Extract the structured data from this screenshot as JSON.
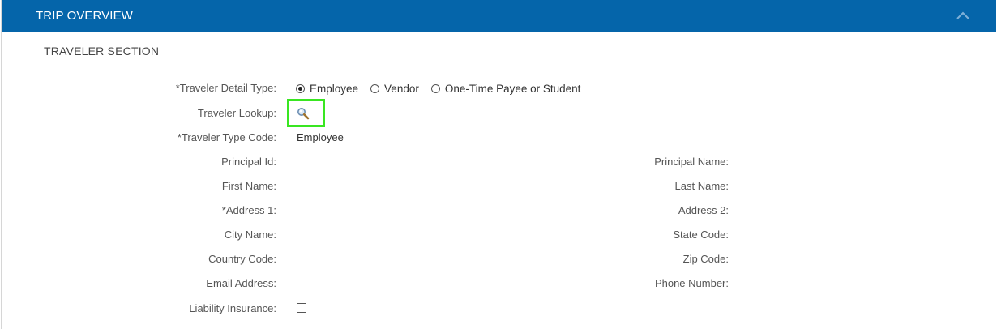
{
  "header": {
    "title": "TRIP OVERVIEW",
    "collapse_icon": "chevron-up-icon",
    "background": "#0565aa"
  },
  "section": {
    "title": "TRAVELER SECTION"
  },
  "traveler_detail_type": {
    "label": "*Traveler Detail Type:",
    "options": [
      {
        "label": "Employee",
        "checked": true
      },
      {
        "label": "Vendor",
        "checked": false
      },
      {
        "label": "One-Time Payee or Student",
        "checked": false
      }
    ]
  },
  "traveler_lookup": {
    "label": "Traveler Lookup:",
    "icon": "magnifier-icon",
    "highlight": "#39e621"
  },
  "traveler_type_code": {
    "label": "*Traveler Type Code:",
    "value": "Employee"
  },
  "fields_left": {
    "principal_id": "Principal Id:",
    "first_name": "First Name:",
    "address1": "*Address 1:",
    "city_name": "City Name:",
    "country_code": "Country Code:",
    "email_address": "Email Address:",
    "liability_insurance": "Liability Insurance:"
  },
  "fields_right": {
    "principal_name": "Principal Name:",
    "last_name": "Last Name:",
    "address2": "Address 2:",
    "state_code": "State Code:",
    "zip_code": "Zip Code:",
    "phone_number": "Phone Number:"
  },
  "liability_insurance_checked": false
}
